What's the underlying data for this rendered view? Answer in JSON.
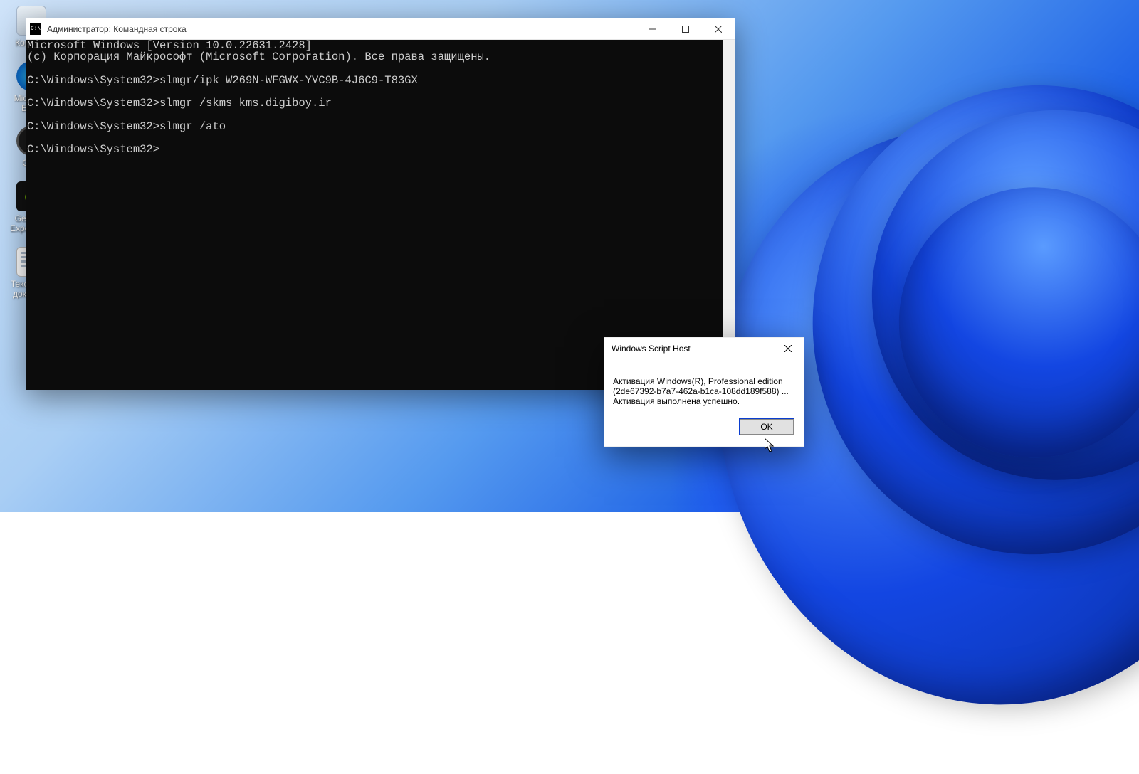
{
  "desktop": {
    "icons": [
      {
        "key": "recycle",
        "label": "Корзина"
      },
      {
        "key": "edge",
        "label": "Microsoft Edge"
      },
      {
        "key": "obs",
        "label": "OBS"
      },
      {
        "key": "nvidia",
        "label": "GeForce Experience"
      },
      {
        "key": "txt",
        "label": "Текстовый документ"
      }
    ]
  },
  "cmd": {
    "title": "Администратор: Командная строка",
    "lines": [
      "Microsoft Windows [Version 10.0.22631.2428]",
      "(c) Корпорация Майкрософт (Microsoft Corporation). Все права защищены.",
      "",
      "C:\\Windows\\System32>slmgr/ipk W269N-WFGWX-YVC9B-4J6C9-T83GX",
      "",
      "C:\\Windows\\System32>slmgr /skms kms.digiboy.ir",
      "",
      "C:\\Windows\\System32>slmgr /ato",
      "",
      "C:\\Windows\\System32>"
    ]
  },
  "dialog": {
    "title": "Windows Script Host",
    "body_line1": "Активация Windows(R), Professional edition",
    "body_line2": "(2de67392-b7a7-462a-b1ca-108dd189f588) ...",
    "body_line3": "Активация выполнена успешно.",
    "ok": "OK"
  }
}
